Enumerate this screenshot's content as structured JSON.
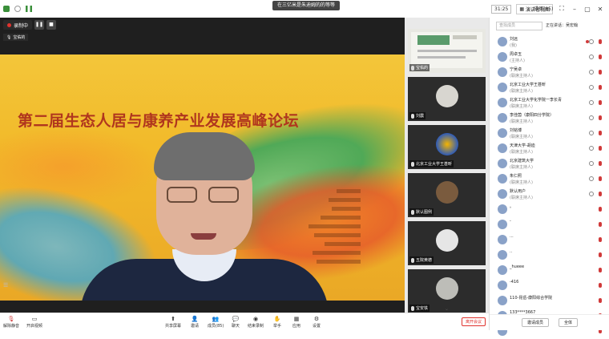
{
  "window": {
    "meeting_title": "在三亿米是朱迪姆的的等等",
    "timer": "31:25",
    "gallery_label": "演讲者视图"
  },
  "recording": {
    "status": "录制中",
    "pause": "❚❚",
    "stop": "■",
    "speaker": "宝佑的"
  },
  "slide": {
    "title": "第二届生态人居与康养产业发展高峰论坛"
  },
  "strip": {
    "tiles": [
      {
        "name": "宝佑的"
      },
      {
        "name": "刘震"
      },
      {
        "name": "北京工业大学王甚昕"
      },
      {
        "name": "默认图例"
      },
      {
        "name": "五院黄德"
      },
      {
        "name": "宝安铁"
      }
    ],
    "more": "⌄"
  },
  "panel": {
    "title": "成员(85)",
    "search_placeholder": "查找成员",
    "host_label": "正在讲话：吴宏翰",
    "participants": [
      {
        "name": "刘远",
        "role": "(我)"
      },
      {
        "name": "周卓玉",
        "role": "(主持人)"
      },
      {
        "name": "宁吴卓",
        "role": "(联席主持人)"
      },
      {
        "name": "北京工业大学王甚昕",
        "role": "(联席主持人)"
      },
      {
        "name": "北京工业大学化学院一李长青",
        "role": "(联席主持人)"
      },
      {
        "name": "李佳茵（康阳四分学院）",
        "role": "(联席主持人)"
      },
      {
        "name": "刘铭博",
        "role": "(联席主持人)"
      },
      {
        "name": "天津大学-胡迪",
        "role": "(联席主持人)"
      },
      {
        "name": "北京建筑大学",
        "role": "(联席主持人)"
      },
      {
        "name": "朱仁照",
        "role": "(联席主持人)"
      },
      {
        "name": "默认用户",
        "role": "(联席主持人)"
      },
      {
        "name": "。",
        "role": ""
      },
      {
        "name": "-",
        "role": ""
      },
      {
        "name": "...",
        "role": ""
      },
      {
        "name": "..",
        "role": ""
      },
      {
        "name": "_hueee",
        "role": ""
      },
      {
        "name": "-416",
        "role": ""
      },
      {
        "name": "110-昆岳-康阳综合学院",
        "role": ""
      },
      {
        "name": "133****3667",
        "role": ""
      },
      {
        "name": "13921890828",
        "role": ""
      }
    ],
    "invite": "邀请成员",
    "mute_all": "全体"
  },
  "toolbar": {
    "items": [
      "解除静音",
      "开启视频",
      "共享屏幕",
      "邀请",
      "成员(85)",
      "聊天",
      "结束录制",
      "举手",
      "应用",
      "设置"
    ],
    "end": "离开会议"
  }
}
